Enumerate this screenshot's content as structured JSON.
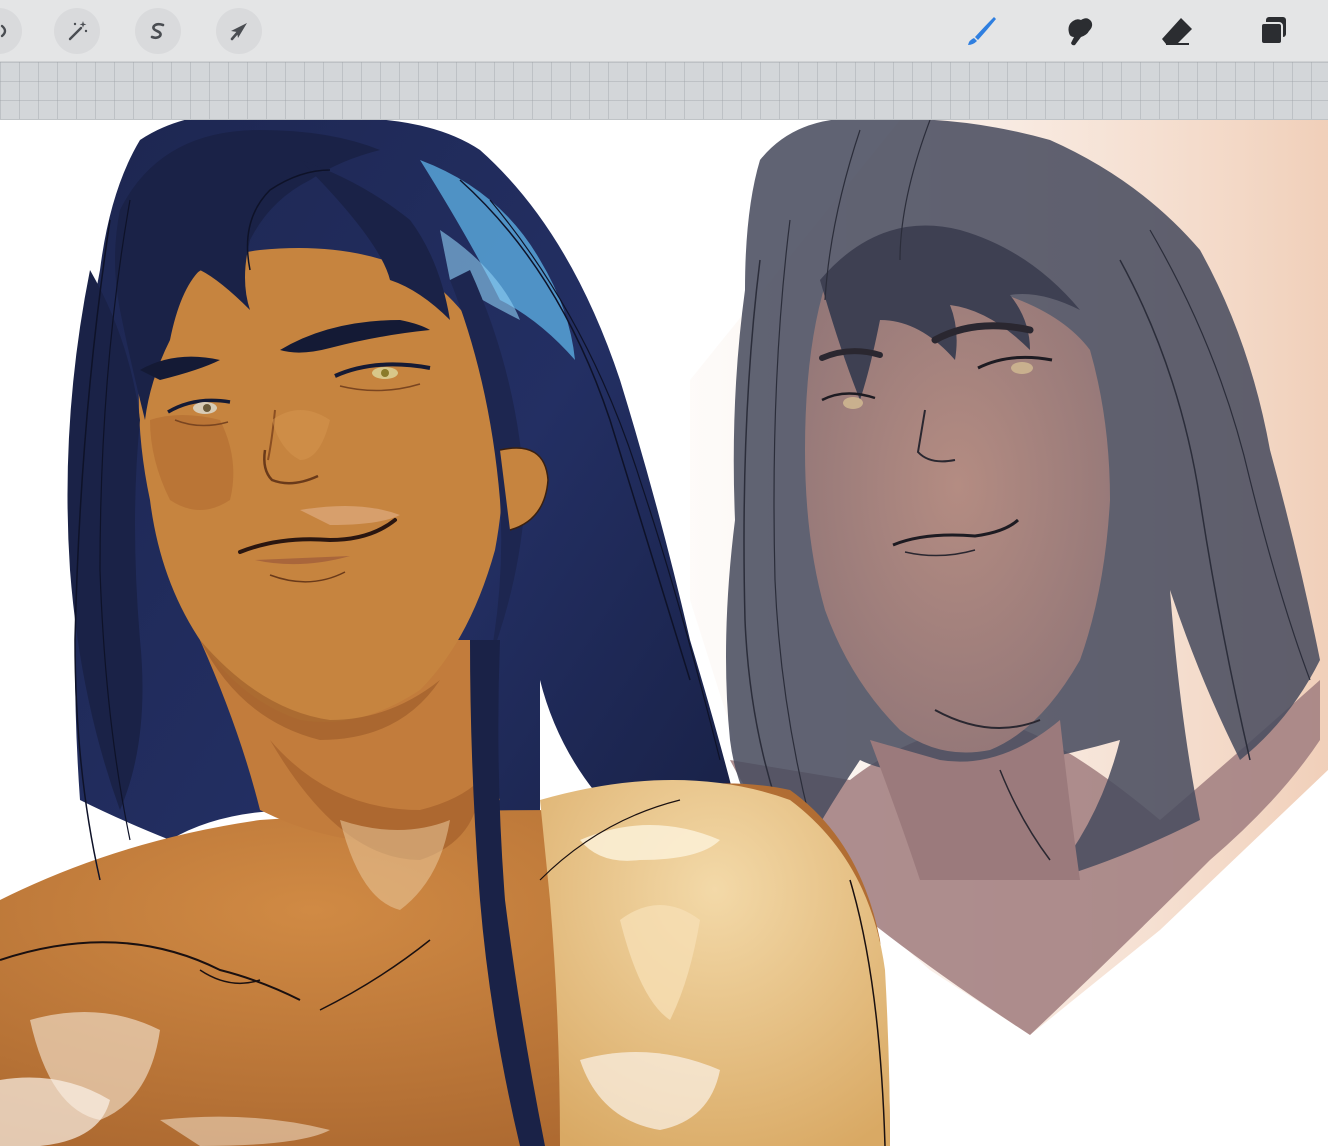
{
  "toolbar": {
    "left_tools": [
      {
        "name": "actions-icon"
      },
      {
        "name": "adjustments-icon"
      },
      {
        "name": "selection-icon"
      },
      {
        "name": "transform-icon"
      }
    ],
    "right_tools": [
      {
        "name": "brush-icon",
        "active": true
      },
      {
        "name": "smudge-icon",
        "active": false
      },
      {
        "name": "eraser-icon",
        "active": false
      },
      {
        "name": "layers-icon",
        "active": false
      }
    ],
    "active_color": "#2f7fe0"
  },
  "canvas": {
    "background": "#ffffff",
    "hair_color": "#1c2547",
    "skin_color": "#c4803f",
    "sketch_tint": "#8b7d86"
  }
}
